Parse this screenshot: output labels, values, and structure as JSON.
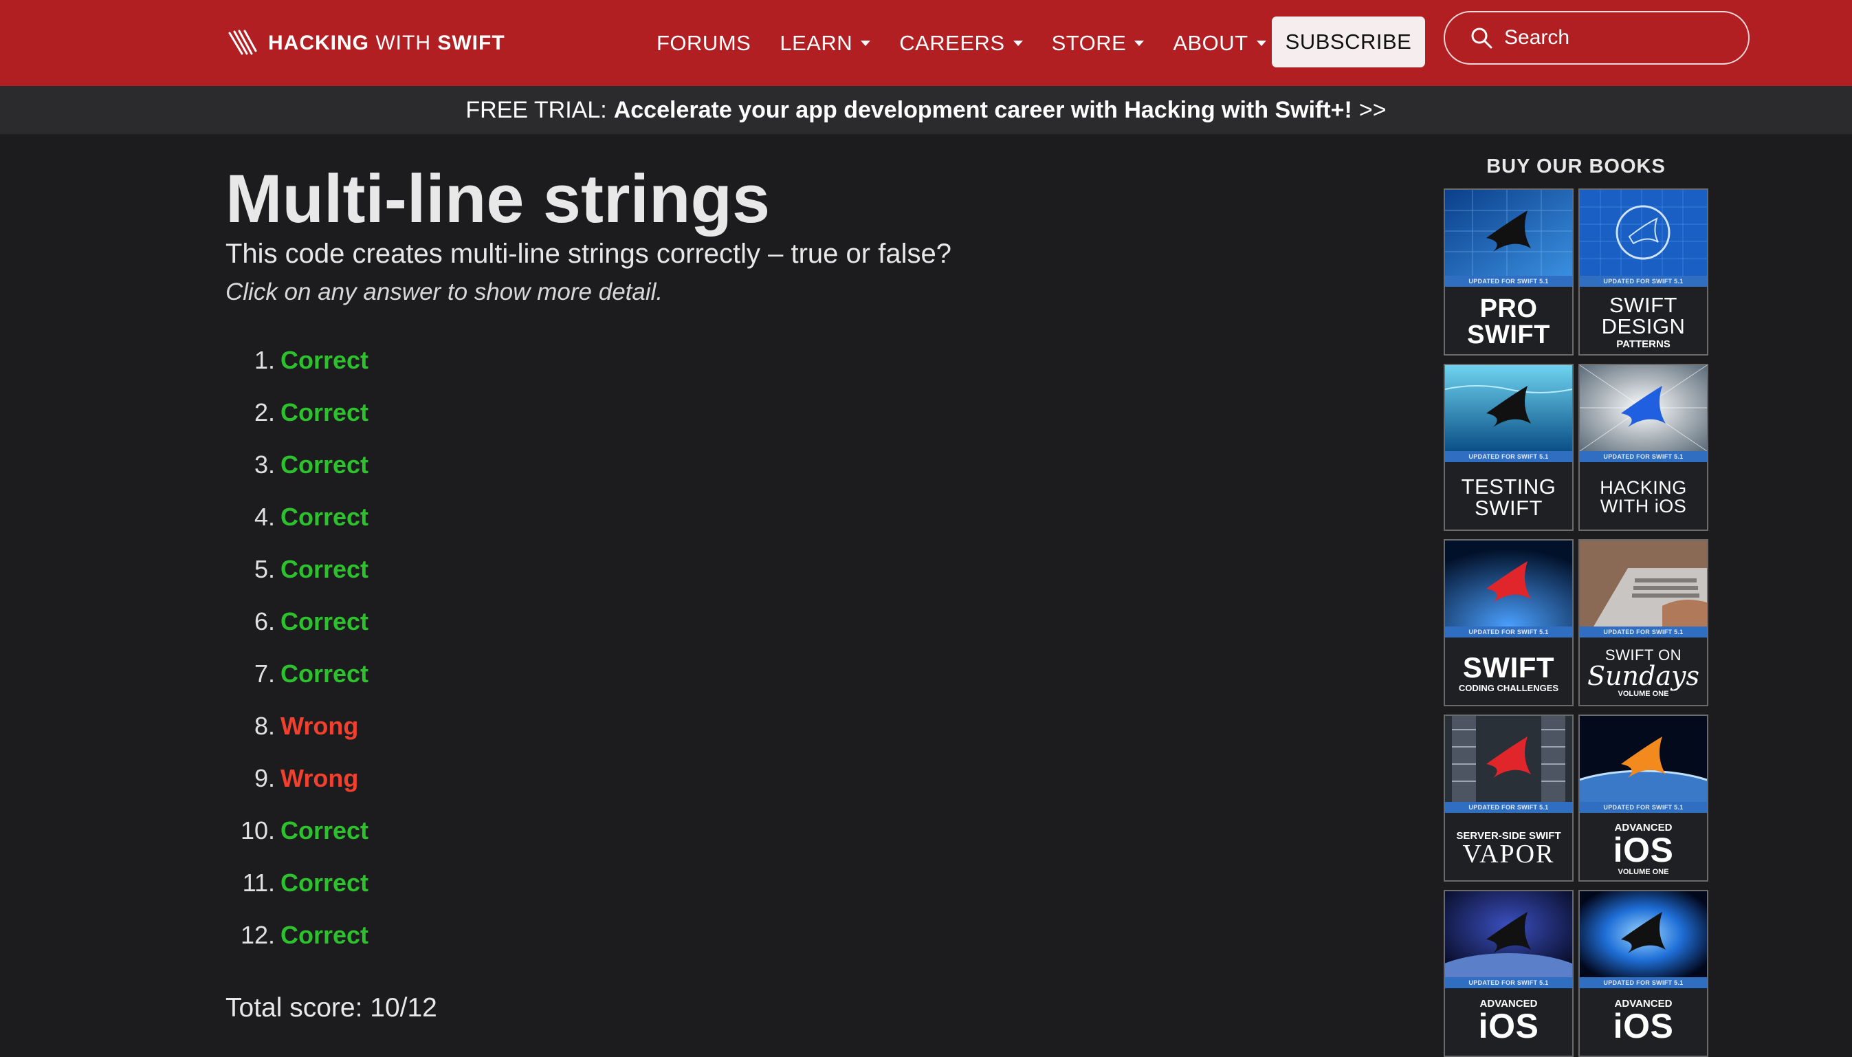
{
  "nav": {
    "logo_bold": "HACKING",
    "logo_light": "WITH",
    "logo_bold2": "SWIFT",
    "items": [
      {
        "label": "FORUMS",
        "dropdown": false
      },
      {
        "label": "LEARN",
        "dropdown": true
      },
      {
        "label": "CAREERS",
        "dropdown": true
      },
      {
        "label": "STORE",
        "dropdown": true
      },
      {
        "label": "ABOUT",
        "dropdown": true
      }
    ],
    "subscribe_label": "SUBSCRIBE",
    "search_placeholder": "Search",
    "colors": {
      "bar": "#b11f23"
    }
  },
  "promo": {
    "prefix": "FREE TRIAL:",
    "text": "Accelerate your app development career with Hacking with Swift+!",
    "suffix": ">>"
  },
  "main": {
    "title": "Multi-line strings",
    "question": "This code creates multi-line strings correctly – true or false?",
    "hint": "Click on any answer to show more detail.",
    "answers": [
      {
        "num": "1.",
        "label": "Correct",
        "status": "correct"
      },
      {
        "num": "2.",
        "label": "Correct",
        "status": "correct"
      },
      {
        "num": "3.",
        "label": "Correct",
        "status": "correct"
      },
      {
        "num": "4.",
        "label": "Correct",
        "status": "correct"
      },
      {
        "num": "5.",
        "label": "Correct",
        "status": "correct"
      },
      {
        "num": "6.",
        "label": "Correct",
        "status": "correct"
      },
      {
        "num": "7.",
        "label": "Correct",
        "status": "correct"
      },
      {
        "num": "8.",
        "label": "Wrong",
        "status": "wrong"
      },
      {
        "num": "9.",
        "label": "Wrong",
        "status": "wrong"
      },
      {
        "num": "10.",
        "label": "Correct",
        "status": "correct"
      },
      {
        "num": "11.",
        "label": "Correct",
        "status": "correct"
      },
      {
        "num": "12.",
        "label": "Correct",
        "status": "correct"
      }
    ],
    "total": "Total score: 10/12",
    "colors": {
      "correct": "#2ec12e",
      "wrong": "#f2402e"
    }
  },
  "sidebar": {
    "heading": "BUY OUR BOOKS",
    "stripe": "UPDATED FOR SWIFT 5.1",
    "books": [
      {
        "id": "pro-swift",
        "lines": [
          "PRO",
          "SWIFT"
        ]
      },
      {
        "id": "swift-design-patterns",
        "lines": [
          "SWIFT",
          "DESIGN",
          "PATTERNS"
        ]
      },
      {
        "id": "testing-swift",
        "lines": [
          "TESTING",
          "SWIFT"
        ]
      },
      {
        "id": "hacking-with-ios",
        "lines": [
          "HACKING",
          "WITH iOS"
        ]
      },
      {
        "id": "swift-coding-challenges",
        "lines": [
          "SWIFT",
          "CODING CHALLENGES"
        ]
      },
      {
        "id": "swift-on-sundays",
        "lines": [
          "SWIFT ON",
          "Sundays",
          "VOLUME ONE"
        ]
      },
      {
        "id": "server-side-swift",
        "lines": [
          "SERVER-SIDE SWIFT",
          "VAPOR"
        ]
      },
      {
        "id": "advanced-ios-1",
        "lines": [
          "ADVANCED",
          "iOS",
          "VOLUME ONE"
        ]
      },
      {
        "id": "advanced-ios-2",
        "lines": [
          "ADVANCED",
          "iOS"
        ]
      },
      {
        "id": "advanced-ios-3",
        "lines": [
          "ADVANCED",
          "iOS"
        ]
      }
    ]
  }
}
